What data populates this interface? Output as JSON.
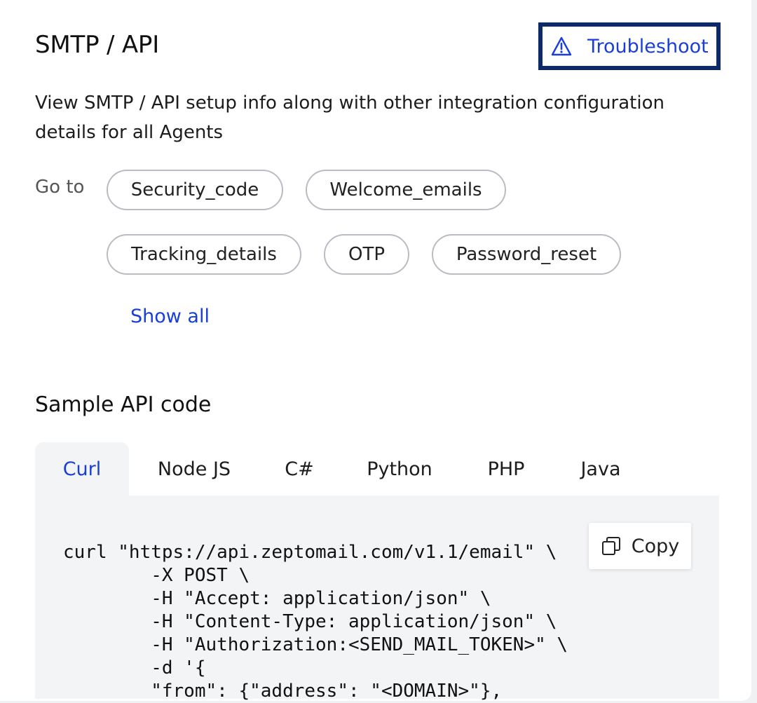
{
  "header": {
    "title": "SMTP / API",
    "troubleshoot_label": "Troubleshoot",
    "troubleshoot_icon": "warning-triangle-icon"
  },
  "description": "View SMTP / API setup info along with other integration configuration details for all Agents",
  "goto": {
    "label": "Go to",
    "chips": [
      "Security_code",
      "Welcome_emails",
      "Tracking_details",
      "OTP",
      "Password_reset"
    ],
    "show_all_label": "Show all"
  },
  "sample": {
    "title": "Sample API code",
    "tabs": [
      {
        "label": "Curl",
        "active": true
      },
      {
        "label": "Node JS",
        "active": false
      },
      {
        "label": "C#",
        "active": false
      },
      {
        "label": "Python",
        "active": false
      },
      {
        "label": "PHP",
        "active": false
      },
      {
        "label": "Java",
        "active": false
      }
    ],
    "copy_label": "Copy",
    "copy_icon": "copy-icon",
    "code": "curl \"https://api.zeptomail.com/v1.1/email\" \\\n        -X POST \\\n        -H \"Accept: application/json\" \\\n        -H \"Content-Type: application/json\" \\\n        -H \"Authorization:<SEND_MAIL_TOKEN>\" \\\n        -d '{\n        \"from\": {\"address\": \"<DOMAIN>\"},"
  },
  "colors": {
    "accent": "#1a3ed8",
    "focus_border": "#0b2a66",
    "chip_border": "#b9bcc2",
    "code_bg": "#f3f4f6"
  }
}
